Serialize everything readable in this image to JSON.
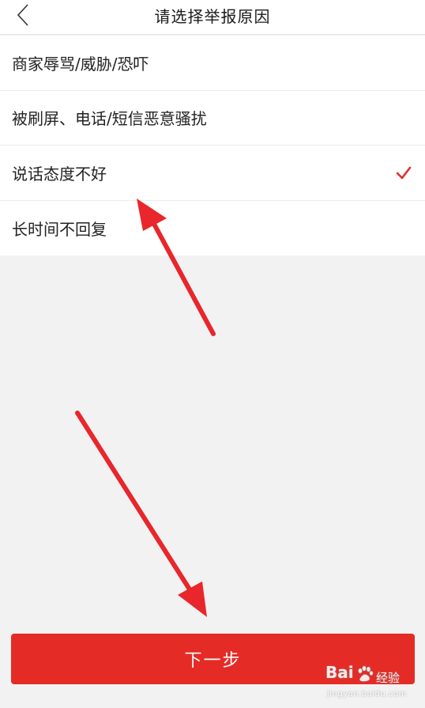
{
  "header": {
    "title": "请选择举报原因",
    "back_icon": "chevron-left-icon"
  },
  "reasons": [
    {
      "label": "商家辱骂/威胁/恐吓",
      "selected": false
    },
    {
      "label": "被刷屏、电话/短信恶意骚扰",
      "selected": false
    },
    {
      "label": "说话态度不好",
      "selected": true
    },
    {
      "label": "长时间不回复",
      "selected": false
    }
  ],
  "next_button": {
    "label": "下一步"
  },
  "watermark": {
    "brand": "Bai",
    "brand_suffix": "经验",
    "url": "jingyan.baidu.com"
  },
  "colors": {
    "accent": "#e52b25",
    "check": "#e0322c",
    "annotation_arrow": "#e8262b",
    "background": "#f2f2f2"
  }
}
